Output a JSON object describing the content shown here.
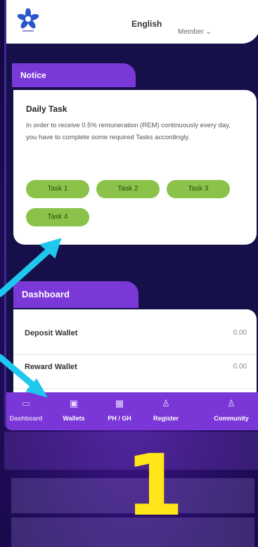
{
  "header": {
    "language": "English",
    "member_menu": "Member ⌄",
    "logo_icon": "star-flower-logo"
  },
  "notice": {
    "tab_label": "Notice",
    "title": "Daily Task",
    "text": "In order to receive 0.5% remuneration (REM) continuously every day, you have to complete some required Tasks accordingly.",
    "tasks": [
      "Task 1",
      "Task 2",
      "Task 3",
      "Task 4"
    ]
  },
  "dashboard": {
    "tab_label": "Dashboard",
    "rows": [
      {
        "label": "Deposit Wallet",
        "value": "0.00"
      },
      {
        "label": "Reward Wallet",
        "value": "0.00"
      }
    ]
  },
  "bottom_nav": [
    {
      "label": "Dashboard",
      "icon": "monitor-icon"
    },
    {
      "label": "Wallets",
      "icon": "wallet-icon"
    },
    {
      "label": "PH / GH",
      "icon": "grid-icon"
    },
    {
      "label": "Register",
      "icon": "user-add-icon"
    },
    {
      "label": "Community",
      "icon": "community-icon"
    }
  ],
  "annotation": {
    "step_number": "1",
    "number_color": "#ffe619",
    "arrow_color": "#1fc7ee"
  },
  "colors": {
    "accent_purple": "#7b38d8",
    "task_green": "#8bc34a",
    "dark_bg": "#15104a"
  }
}
